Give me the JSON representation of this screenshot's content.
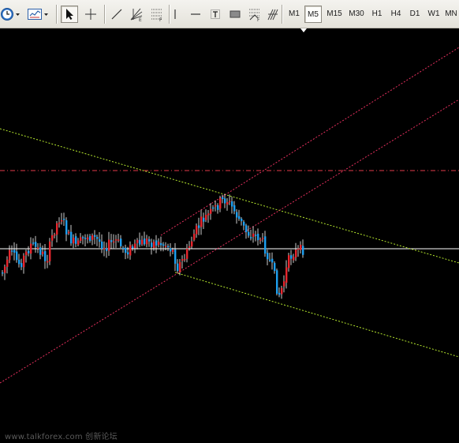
{
  "toolbar": {
    "tools": [
      {
        "name": "clock-icon"
      },
      {
        "name": "chart-template-icon"
      },
      {
        "name": "cursor-arrow-icon"
      },
      {
        "name": "crosshair-icon"
      },
      {
        "name": "trendline-icon"
      },
      {
        "name": "fibonacci-fan-icon"
      },
      {
        "name": "fibonacci-retracement-icon"
      },
      {
        "name": "vertical-line-icon"
      },
      {
        "name": "horizontal-line-icon"
      },
      {
        "name": "text-tool-icon"
      },
      {
        "name": "rectangle-icon"
      },
      {
        "name": "fibonacci-expansion-icon"
      },
      {
        "name": "andrews-pitchfork-icon"
      }
    ],
    "timeframes": [
      "M1",
      "M5",
      "M15",
      "M30",
      "H1",
      "H4",
      "D1",
      "W1",
      "MN"
    ],
    "active_timeframe": "M5"
  },
  "colors": {
    "background": "#000000",
    "bull_candle": "#e8262d",
    "bear_candle": "#1ea0f0",
    "wick": "#ffffff",
    "channel_line": "#e5305e",
    "trendline": "#b6e82e",
    "resistance_line": "#e23a4a",
    "current_price_line": "#ffffff"
  },
  "watermark": "www.talkforex.com 创新论坛"
}
